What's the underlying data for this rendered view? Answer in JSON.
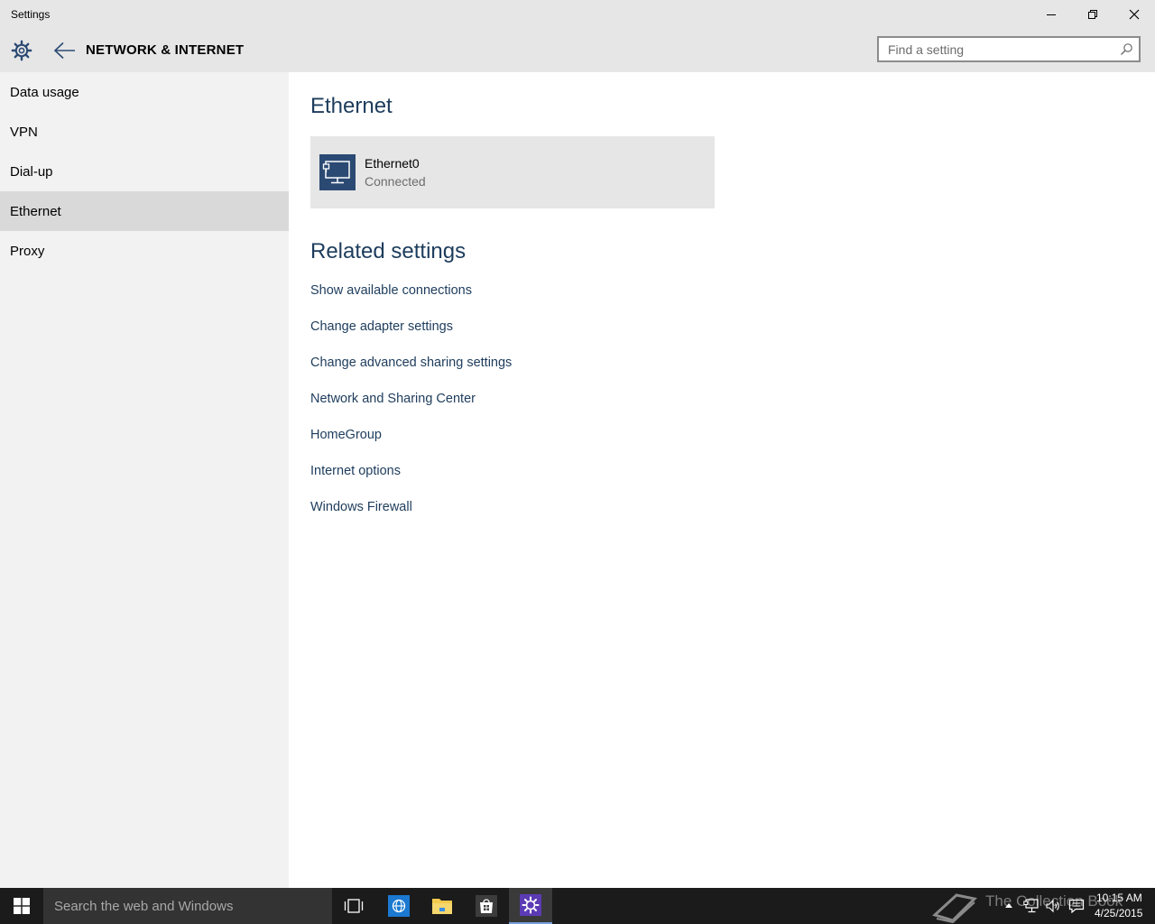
{
  "window": {
    "title": "Settings",
    "controls": [
      "minimize-icon",
      "restore-icon",
      "close-icon"
    ]
  },
  "header": {
    "section_title": "NETWORK & INTERNET",
    "search_placeholder": "Find a setting",
    "icons": [
      "gear-icon",
      "back-arrow-icon",
      "search-icon"
    ]
  },
  "sidebar": {
    "items": [
      {
        "label": "Data usage",
        "selected": false
      },
      {
        "label": "VPN",
        "selected": false
      },
      {
        "label": "Dial-up",
        "selected": false
      },
      {
        "label": "Ethernet",
        "selected": true
      },
      {
        "label": "Proxy",
        "selected": false
      }
    ]
  },
  "main": {
    "heading": "Ethernet",
    "connection": {
      "name": "Ethernet0",
      "status": "Connected",
      "icon": "ethernet-icon"
    },
    "related_heading": "Related settings",
    "related_links": [
      "Show available connections",
      "Change adapter settings",
      "Change advanced sharing settings",
      "Network and Sharing Center",
      "HomeGroup",
      "Internet options",
      "Windows Firewall"
    ]
  },
  "taskbar": {
    "search_placeholder": "Search the web and Windows",
    "pinned": [
      "task-view-icon",
      "internet-explorer-icon",
      "file-explorer-icon",
      "store-icon",
      "settings-icon"
    ],
    "active_app": "settings-icon",
    "tray_icons": [
      "show-hidden-icons-icon",
      "network-icon",
      "volume-icon",
      "action-center-icon"
    ],
    "watermark": "The Collection Book",
    "time": "10:15 AM",
    "date": "4/25/2015"
  },
  "colors": {
    "chrome_bg": "#e6e6e6",
    "sidebar_bg": "#f2f2f2",
    "selected_item_bg": "#d9d9d9",
    "accent_text": "#1d3c5c",
    "tile_bg": "#2b4a73",
    "taskbar_bg": "#1b1b1b"
  }
}
